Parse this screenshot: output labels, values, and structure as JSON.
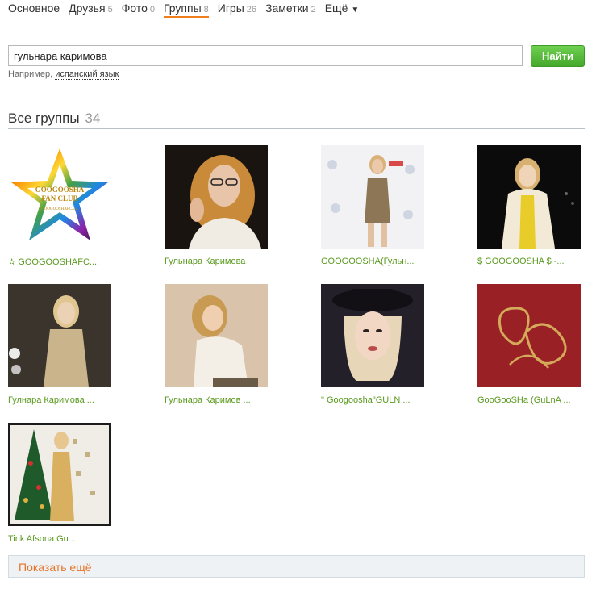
{
  "tabs": [
    {
      "label": "Основное",
      "count": ""
    },
    {
      "label": "Друзья",
      "count": "5"
    },
    {
      "label": "Фото",
      "count": "0"
    },
    {
      "label": "Группы",
      "count": "8"
    },
    {
      "label": "Игры",
      "count": "26"
    },
    {
      "label": "Заметки",
      "count": "2"
    },
    {
      "label": "Ещё",
      "count": ""
    }
  ],
  "search": {
    "value": "гульнара каримова",
    "button_label": "Найти",
    "hint_prefix": "Например,",
    "hint_link": "испанский язык"
  },
  "section": {
    "title": "Все группы",
    "count": "34"
  },
  "groups": [
    {
      "name": "✫ GOOGOOSHAFC....",
      "logo_lines": [
        "GOOGOOSHA",
        "FAN CLUB",
        "GOOGOOSHAFC.UZ"
      ]
    },
    {
      "name": "Гульнара Каримова"
    },
    {
      "name": "GOOGOOSHA(Гульн..."
    },
    {
      "name": "$ GOOGOOSHA $ -..."
    },
    {
      "name": "Гулнара Каримова ..."
    },
    {
      "name": "Гульнара Каримов ..."
    },
    {
      "name": "\" Googoosha\"GULN ..."
    },
    {
      "name": "GooGooSHa (GuLnA ..."
    },
    {
      "name": "Tirik Afsona Gu ..."
    }
  ],
  "show_more": "Показать ещё",
  "colors": {
    "accent_orange": "#f07e1a",
    "link_green": "#5a9a1f",
    "button_green": "#45a82c"
  }
}
